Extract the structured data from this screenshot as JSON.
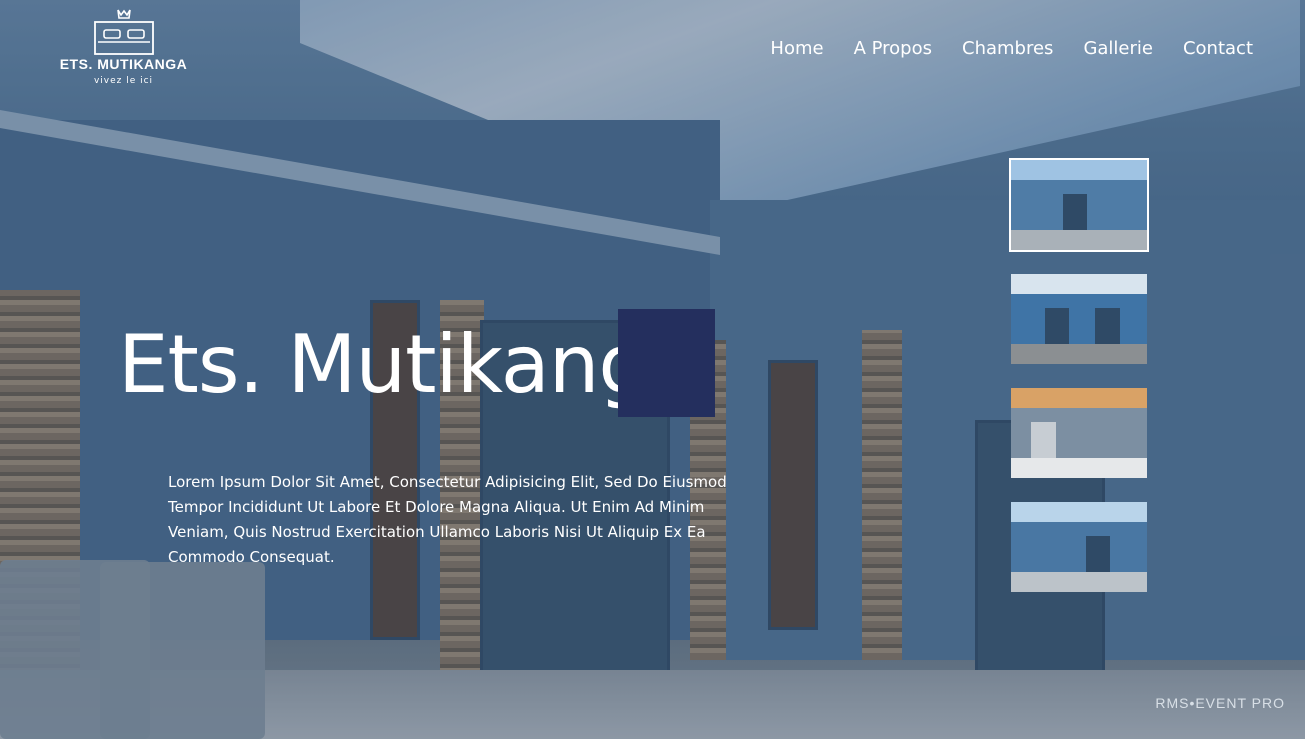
{
  "brand": {
    "name": "ETS. MUTIKANGA",
    "tagline": "vivez le ici",
    "logo_icon": "bed-crown-icon"
  },
  "nav": {
    "items": [
      {
        "label": "Home"
      },
      {
        "label": "A Propos"
      },
      {
        "label": "Chambres"
      },
      {
        "label": "Gallerie"
      },
      {
        "label": "Contact"
      }
    ]
  },
  "hero": {
    "title": "Ets. Mutikanga",
    "text": "Lorem Ipsum Dolor Sit Amet, Consectetur Adipisicing Elit, Sed Do Eiusmod Tempor Incididunt Ut Labore Et Dolore Magna Aliqua. Ut Enim Ad Minim Veniam, Quis Nostrud Exercitation Ullamco Laboris Nisi Ut Aliquip Ex Ea Commodo Consequat.",
    "accent_color": "#242f5e"
  },
  "gallery": {
    "active_index": 0,
    "thumbnails": [
      {
        "id": "thumb-1",
        "active": true
      },
      {
        "id": "thumb-2",
        "active": false
      },
      {
        "id": "thumb-3",
        "active": false
      },
      {
        "id": "thumb-4",
        "active": false
      }
    ]
  },
  "watermark": "RMS•EVENT PRO"
}
